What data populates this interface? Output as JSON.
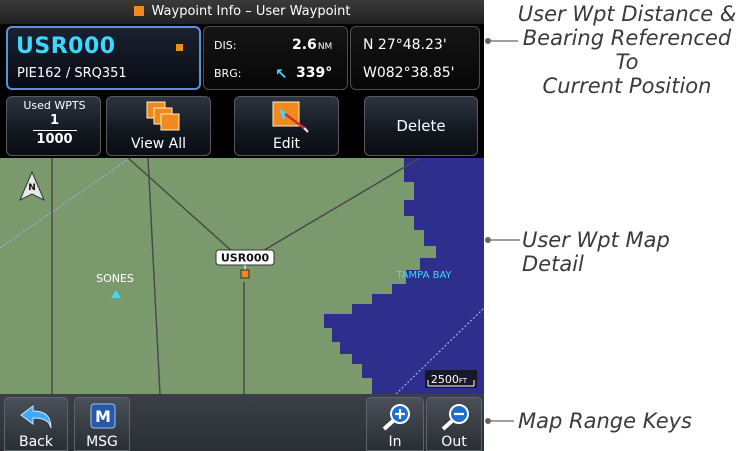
{
  "window": {
    "title": "Waypoint Info – User Waypoint"
  },
  "waypoint": {
    "ident": "USR000",
    "comment": "PIE162 / SRQ351",
    "dis_label": "DIS:",
    "dis_value": "2.6",
    "dis_unit": "NM",
    "brg_label": "BRG:",
    "brg_value": "339°",
    "latitude": "N 27°48.23'",
    "longitude": "W082°38.85'"
  },
  "buttons": {
    "used_wpts_label": "Used WPTS",
    "used_wpts_count": "1",
    "used_wpts_max": "1000",
    "view_all": "View All",
    "edit": "Edit",
    "delete": "Delete"
  },
  "map": {
    "north_label": "N",
    "wpt_label": "USR000",
    "sones_label": "SONES",
    "tampa_bay_label": "TAMPA BAY",
    "range_value": "2500",
    "range_unit": "FT"
  },
  "bottom_keys": {
    "back": "Back",
    "msg": "MSG",
    "zoom_in": "In",
    "zoom_out": "Out"
  },
  "callouts": {
    "distance_bearing_line1": "User Wpt Distance &",
    "distance_bearing_line2": "Bearing Referenced To",
    "distance_bearing_line3": "Current Position",
    "map_detail": "User Wpt Map Detail",
    "range_keys": "Map Range Keys"
  },
  "colors": {
    "accent_cyan": "#3fd6ff",
    "wpt_orange": "#f08a1e",
    "map_land": "#7a9a6e",
    "map_water": "#2e2e8c"
  }
}
